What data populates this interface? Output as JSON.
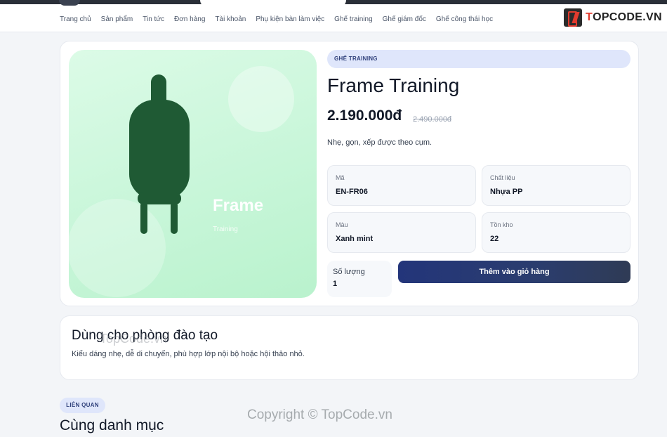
{
  "nav": {
    "items": [
      "Trang chủ",
      "Sản phẩm",
      "Tin tức",
      "Đơn hàng",
      "Tài khoản",
      "Phụ kiện bàn làm việc",
      "Ghế training",
      "Ghế giám đốc",
      "Ghế công thái học"
    ]
  },
  "logo": {
    "prefix": "T",
    "rest": "OPCODE.VN",
    "icon": "topcode-logo-icon"
  },
  "product": {
    "category": "GHẾ TRAINING",
    "title": "Frame Training",
    "price": "2.190.000đ",
    "price_old": "2.490.000đ",
    "description": "Nhẹ, gọn, xếp được theo cụm.",
    "image": {
      "title": "Frame",
      "subtitle": "Training",
      "bg_color": "#c8f6d9",
      "chair_color": "#1f5a34"
    },
    "specs": [
      {
        "label": "Mã",
        "value": "EN-FR06"
      },
      {
        "label": "Chất liệu",
        "value": "Nhựa PP"
      },
      {
        "label": "Màu",
        "value": "Xanh mint"
      },
      {
        "label": "Tồn kho",
        "value": "22"
      }
    ],
    "quantity": {
      "label": "Số lượng",
      "value": "1"
    },
    "add_to_cart": "Thêm vào giỏ hàng",
    "accent_color": "#23357a"
  },
  "detail": {
    "title": "Dùng cho phòng đào tạo",
    "text": "Kiểu dáng nhẹ, dễ di chuyển, phù hợp lớp nội bộ hoặc hội thảo nhỏ."
  },
  "related": {
    "badge": "LIÊN QUAN",
    "title": "Cùng danh mục"
  },
  "watermark": {
    "center": "TopCode.vn",
    "footer": "Copyright © TopCode.vn"
  }
}
